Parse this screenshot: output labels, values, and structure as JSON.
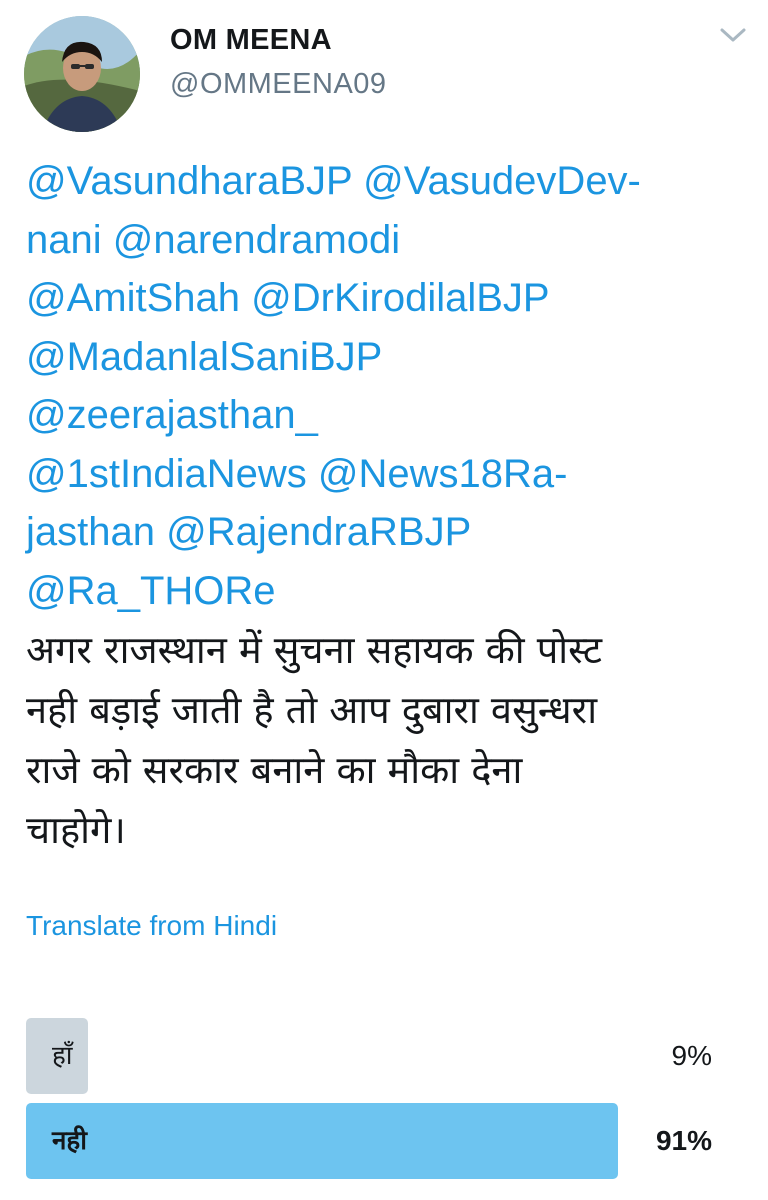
{
  "tweet": {
    "author": {
      "display_name": "OM MEENA",
      "handle": "@OMMEENA09",
      "avatar_icon": "user-avatar-photo"
    },
    "menu_icon": "chevron-down-icon",
    "mention_lines": [
      [
        "@VasundharaBJP",
        "@VasudevDev-"
      ],
      [
        "nani",
        "@narendramodi"
      ],
      [
        "@AmitShah",
        "@DrKirodilalBJP"
      ],
      [
        "@MadanlalSaniBJP"
      ],
      [
        "@zeerajasthan_"
      ],
      [
        "@1stIndiaNews",
        "@News18Ra-"
      ],
      [
        "jasthan",
        "@RajendraRBJP"
      ],
      [
        "@Ra_THORe"
      ]
    ],
    "hindi_lines": [
      "अगर राजस्थान में सुचना सहायक की पोस्ट",
      "नही बड़ाई जाती है तो आप दुबारा वसुन्धरा",
      "राजे को सरकार बनाने का मौका देना",
      "चाहोगे।"
    ],
    "translate_label": "Translate from Hindi",
    "poll": {
      "options": [
        {
          "label": "हाँ",
          "percent_text": "9%",
          "percent": 9,
          "winner": false
        },
        {
          "label": "नही",
          "percent_text": "91%",
          "percent": 91,
          "winner": true
        }
      ]
    },
    "colors": {
      "link": "#1b95e0",
      "text": "#14171a",
      "muted": "#657786",
      "poll_loser": "#ccd6dd",
      "poll_winner": "#6dc4f0"
    }
  }
}
